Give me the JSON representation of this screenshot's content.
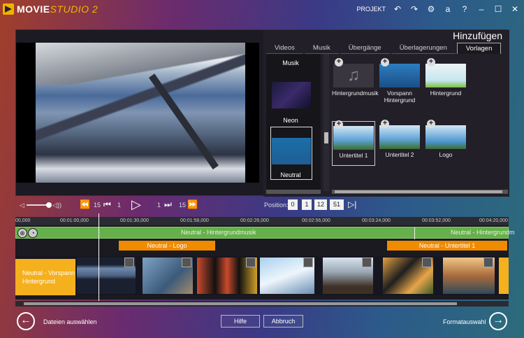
{
  "app": {
    "logo_main": "MOVIE",
    "logo_sub": "STUDIO 2"
  },
  "topbar": {
    "projekt_label": "PROJEKT",
    "undo_icon": "undo-icon",
    "redo_icon": "redo-icon",
    "settings_icon": "gear-icon",
    "font_label": "a",
    "help_label": "?"
  },
  "panel": {
    "title": "Hinzufügen",
    "tabs": [
      {
        "label": "Videos"
      },
      {
        "label": "Musik"
      },
      {
        "label": "Übergänge"
      },
      {
        "label": "Überlagerungen"
      },
      {
        "label": "Vorlagen"
      }
    ],
    "active_tab": 4,
    "categories": [
      {
        "label": "Musik"
      },
      {
        "label": "Neon"
      },
      {
        "label": "Neutral"
      }
    ],
    "items": [
      {
        "label": "Hintergrundmusik"
      },
      {
        "label": "Vorspann Hintergrund"
      },
      {
        "label": "Hintergrund"
      },
      {
        "label": "Untertitel 1"
      },
      {
        "label": "Untertitel 2"
      },
      {
        "label": "Logo"
      }
    ]
  },
  "transport": {
    "skip_back_label": "15",
    "step_back_label": "1",
    "step_fwd_label": "1",
    "skip_fwd_label": "15",
    "position_label": "Position:",
    "position": [
      "0",
      "1",
      "12",
      "51"
    ]
  },
  "ruler": {
    "ticks": [
      "00,000",
      "00:01:00,000",
      "00:01:30,000",
      "00:01:58,000",
      "00:02:26,000",
      "00:02:56,000",
      "00:03:24,000",
      "00:03:52,000",
      "00:04:20,000"
    ]
  },
  "timeline": {
    "audio_clip_1": "Neutral - Hintergrundmusik",
    "audio_clip_2": "Neutral - Hintergrundm",
    "title_clip_1": "Neutral - Logo",
    "title_clip_2": "Neutral - Untertitel 1",
    "video_clip_first": "Neutral - Vorspann Hintergrund"
  },
  "bottom": {
    "back_label": "Dateien auswählen",
    "help_button": "Hilfe",
    "cancel_button": "Abbruch",
    "next_label": "Formatauswahl"
  },
  "colors": {
    "accent_orange": "#f08a00",
    "audio_green": "#65b04a",
    "clip_yellow": "#f5b01e"
  }
}
